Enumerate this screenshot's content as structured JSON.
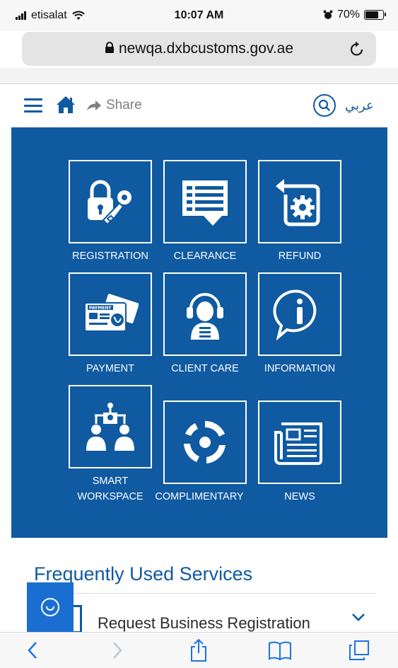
{
  "status_bar": {
    "carrier": "etisalat",
    "time": "10:07 AM",
    "battery": "70%"
  },
  "browser": {
    "url": "newqa.dxbcustoms.gov.ae"
  },
  "site_toolbar": {
    "share_label": "Share",
    "language_label": "عربي"
  },
  "services": [
    {
      "label": "REGISTRATION",
      "icon": "lock-key-icon"
    },
    {
      "label": "CLEARANCE",
      "icon": "document-list-icon"
    },
    {
      "label": "REFUND",
      "icon": "refund-gear-icon"
    },
    {
      "label": "PAYMENT",
      "icon": "payment-card-icon"
    },
    {
      "label": "CLIENT CARE",
      "icon": "headset-agent-icon"
    },
    {
      "label": "INFORMATION",
      "icon": "info-bubble-icon"
    },
    {
      "label": "SMART WORKSPACE",
      "label_line1": "SMART",
      "label_line2": "WORKSPACE",
      "icon": "workspace-people-icon"
    },
    {
      "label": "COMPLIMENTARY",
      "icon": "circular-arrows-icon"
    },
    {
      "label": "NEWS",
      "icon": "newspaper-icon"
    }
  ],
  "payment_card_text": "PAYMENT",
  "frequently_used": {
    "title": "Frequently Used Services",
    "items": [
      {
        "label": "Request Business Registration"
      }
    ]
  },
  "colors": {
    "brand_blue": "#0f5aa1",
    "chat_blue": "#1a6ed1"
  }
}
